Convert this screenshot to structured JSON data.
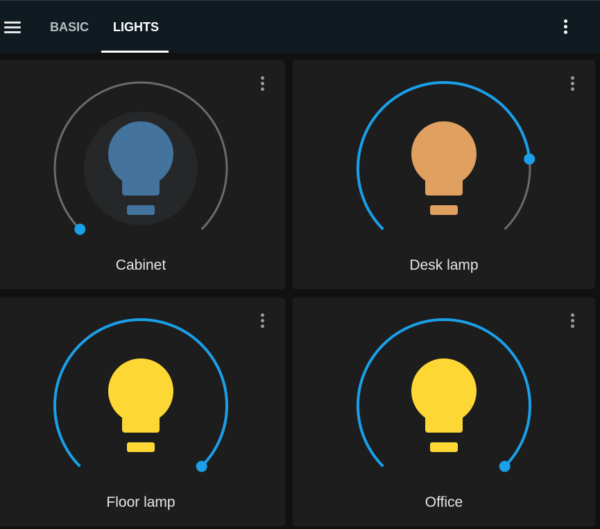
{
  "header": {
    "tabs": [
      {
        "label": "BASIC"
      },
      {
        "label": "LIGHTS",
        "active": true
      }
    ]
  },
  "colors": {
    "accent": "#1a9fe8",
    "track_off": "#6b6b6b",
    "bulb_off": "#44739e",
    "bulb_warm": "#e0a060",
    "bulb_on": "#fdd835",
    "card_bg": "#1d1d1d",
    "header_bg": "#101b21"
  },
  "lights": [
    {
      "name": "Cabinet",
      "state": "off",
      "brightness": 0.0,
      "icon": "lightbulb-icon"
    },
    {
      "name": "Desk lamp",
      "state": "on",
      "brightness": 0.81,
      "icon": "lightbulb-icon"
    },
    {
      "name": "Floor lamp",
      "state": "on",
      "brightness": 1.0,
      "icon": "lightbulb-icon"
    },
    {
      "name": "Office",
      "state": "on",
      "brightness": 1.0,
      "icon": "lightbulb-icon"
    }
  ]
}
